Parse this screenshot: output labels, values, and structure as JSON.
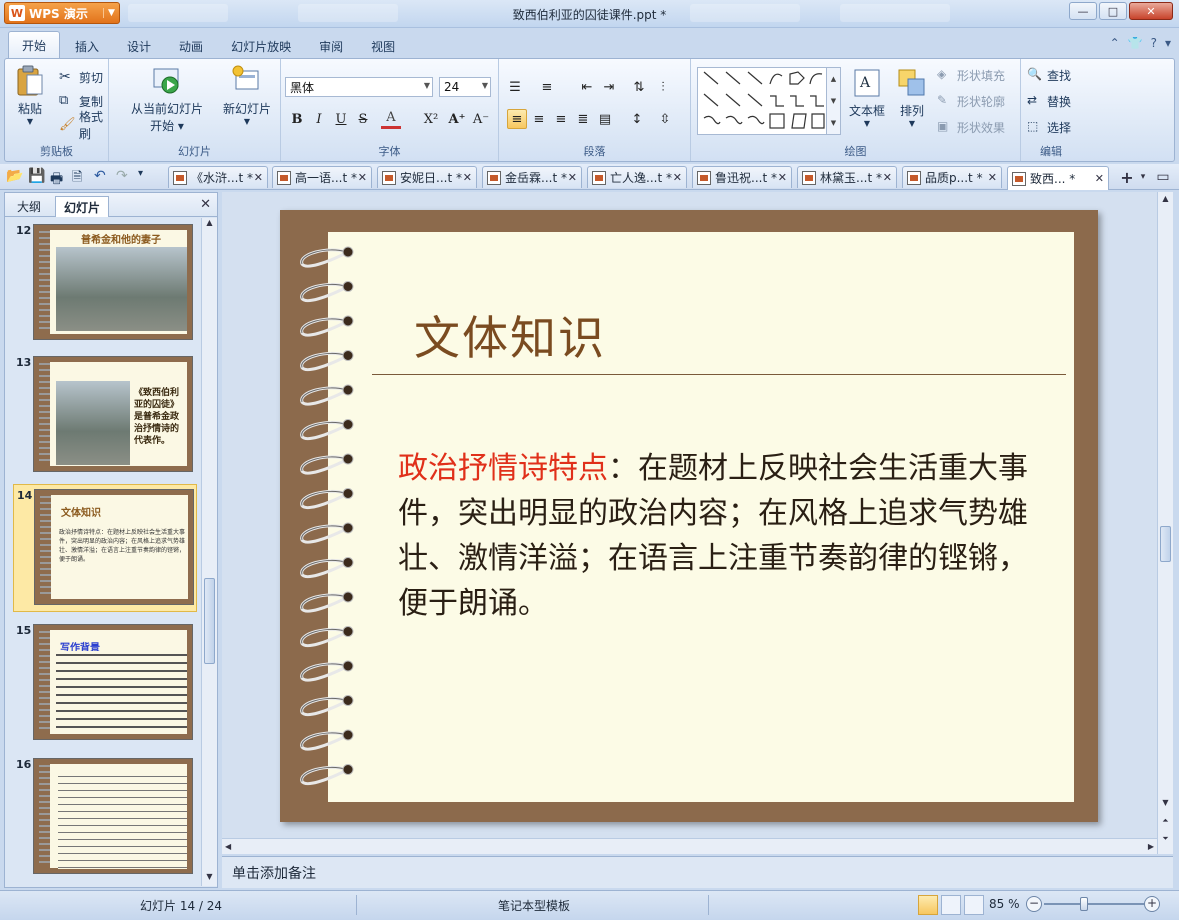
{
  "app": {
    "button_label": "WPS 演示",
    "logo_letter": "W"
  },
  "window": {
    "title": "致西伯利亚的囚徒课件.ppt *",
    "minimize": "—",
    "maximize": "□",
    "close": "✕"
  },
  "ribbon_tabs": [
    {
      "label": "开始",
      "active": true
    },
    {
      "label": "插入"
    },
    {
      "label": "设计"
    },
    {
      "label": "动画"
    },
    {
      "label": "幻灯片放映"
    },
    {
      "label": "审阅"
    },
    {
      "label": "视图"
    }
  ],
  "clipboard": {
    "paste": "粘贴",
    "cut": "剪切",
    "copy": "复制",
    "format_painter": "格式刷",
    "group_label": "剪贴板"
  },
  "slides_group": {
    "from_current": "从当前幻灯片",
    "start": "开始",
    "new_slide": "新幻灯片",
    "group_label": "幻灯片"
  },
  "font_group": {
    "font_name": "黑体",
    "font_size": "24",
    "group_label": "字体"
  },
  "paragraph_group": {
    "group_label": "段落"
  },
  "drawing_group": {
    "textbox": "文本框",
    "arrange": "排列",
    "shape_fill": "形状填充",
    "shape_outline": "形状轮廓",
    "shape_effect": "形状效果",
    "group_label": "绘图"
  },
  "edit_group": {
    "find": "查找",
    "replace": "替换",
    "select": "选择",
    "group_label": "编辑"
  },
  "doc_tabs": [
    {
      "label": "《水浒...t *",
      "close": "✕"
    },
    {
      "label": "高一语...t *",
      "close": "✕"
    },
    {
      "label": "安妮日...t *",
      "close": "✕"
    },
    {
      "label": "金岳霖...t *",
      "close": "✕"
    },
    {
      "label": "亡人逸...t *",
      "close": "✕"
    },
    {
      "label": "鲁迅祝...t *",
      "close": "✕"
    },
    {
      "label": "林黛玉...t *",
      "close": "✕"
    },
    {
      "label": "品质p...t *",
      "close": "✕"
    },
    {
      "label": "致西... *",
      "close": "✕",
      "active": true
    }
  ],
  "left_panel": {
    "tab_outline": "大纲",
    "tab_slides": "幻灯片",
    "close": "✕",
    "thumbnails": [
      {
        "number": "12",
        "title": "普希金和他的妻子"
      },
      {
        "number": "13",
        "side_text": "《致西伯利亚的囚徒》是普希金政治抒情诗的代表作。"
      },
      {
        "number": "14",
        "title": "文体知识",
        "text": "政治抒情诗特点：在题材上反映社会生活重大事件，突出明显的政治内容；在风格上追求气势雄壮、激情洋溢；在语言上注重节奏韵律的铿锵，便于朗诵。",
        "selected": true
      },
      {
        "number": "15",
        "title": "写作背景"
      },
      {
        "number": "16"
      }
    ]
  },
  "slide": {
    "heading": "文体知识",
    "highlight": "政治抒情诗特点",
    "body": "：在题材上反映社会生活重大事件，突出明显的政治内容；在风格上追求气势雄壮、激情洋溢；在语言上注重节奏韵律的铿锵，便于朗诵。"
  },
  "notes": {
    "placeholder": "单击添加备注"
  },
  "status": {
    "slide_counter": "幻灯片 14 / 24",
    "template": "笔记本型模板",
    "zoom": "85 %"
  },
  "colors": {
    "accent_orange": "#e2731b",
    "slide_frame": "#8c6a4c",
    "slide_paper": "#fcfbe6",
    "heading": "#7a4b20",
    "highlight": "#e0301a"
  }
}
